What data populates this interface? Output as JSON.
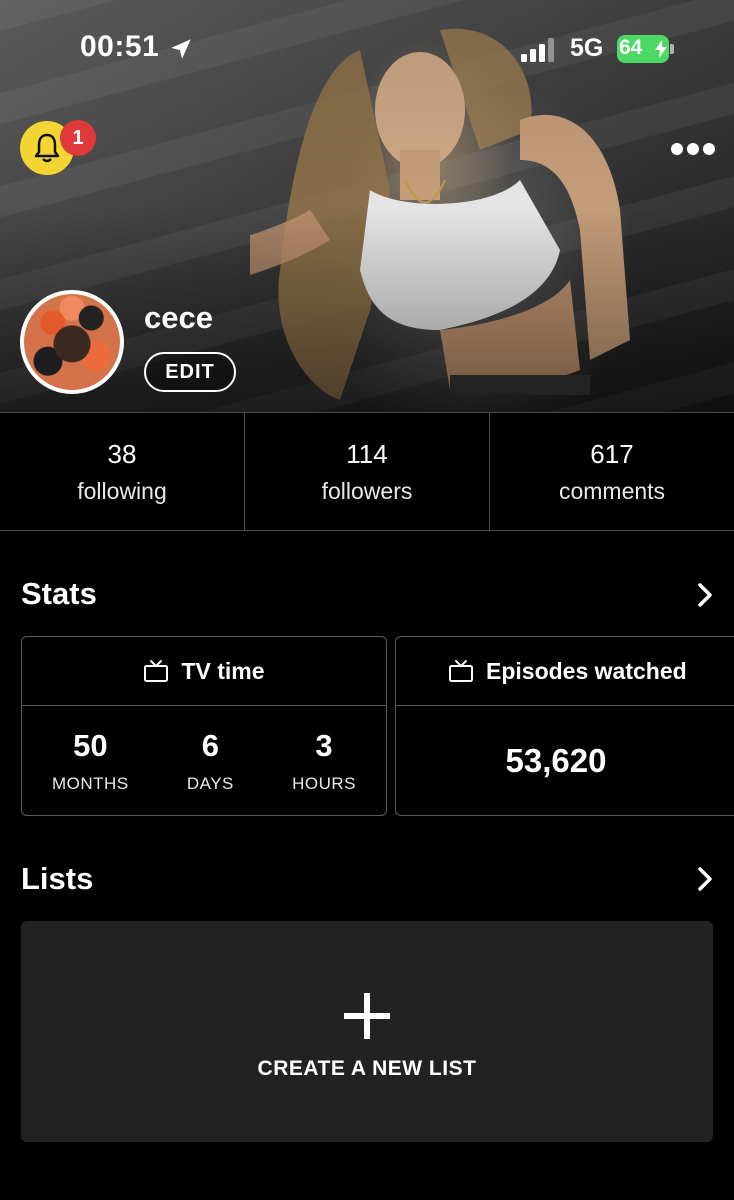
{
  "status_bar": {
    "time": "00:51",
    "network": "5G",
    "battery": "64",
    "icons": [
      "location-arrow-icon",
      "signal-bars-icon",
      "battery-charging-icon"
    ]
  },
  "header": {
    "notification_count": "1",
    "bell_color": "#f3d534",
    "badge_color": "#e0393a",
    "more_icon": "more-dots-icon"
  },
  "profile": {
    "username": "cece",
    "edit_label": "EDIT"
  },
  "counts": [
    {
      "value": "38",
      "label": "following"
    },
    {
      "value": "114",
      "label": "followers"
    },
    {
      "value": "617",
      "label": "comments"
    }
  ],
  "stats": {
    "title": "Stats",
    "tv_time": {
      "label": "TV time",
      "months": "50",
      "months_label": "MONTHS",
      "days": "6",
      "days_label": "DAYS",
      "hours": "3",
      "hours_label": "HOURS"
    },
    "episodes": {
      "label": "Episodes watched",
      "value": "53,620"
    }
  },
  "lists": {
    "title": "Lists",
    "create_label": "CREATE A NEW LIST"
  }
}
